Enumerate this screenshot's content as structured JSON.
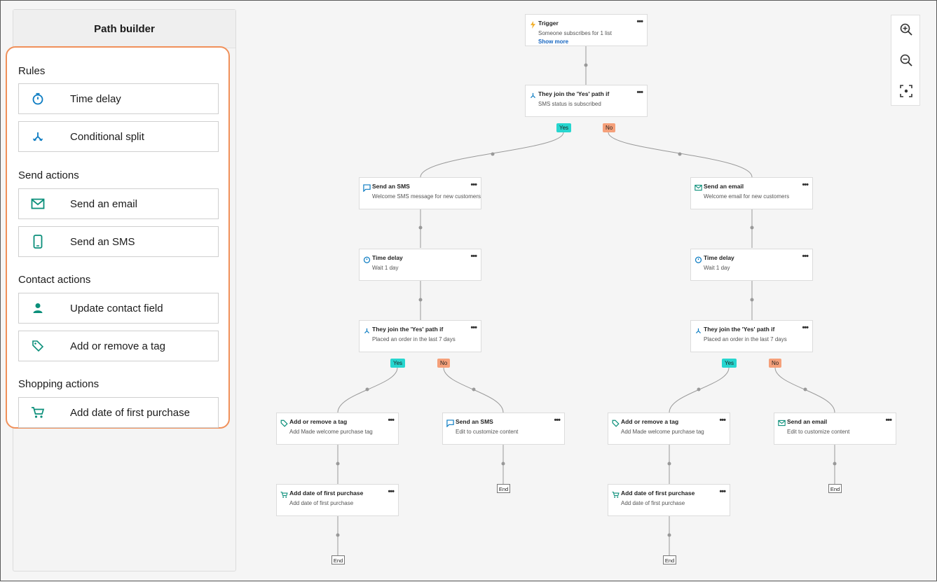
{
  "sidebar": {
    "title": "Path builder",
    "sections": {
      "rules": {
        "title": "Rules",
        "items": [
          {
            "label": "Time delay",
            "icon": "stopwatch-icon"
          },
          {
            "label": "Conditional split",
            "icon": "split-icon"
          }
        ]
      },
      "send": {
        "title": "Send actions",
        "items": [
          {
            "label": "Send an email",
            "icon": "envelope-icon"
          },
          {
            "label": "Send an SMS",
            "icon": "mobile-phone-icon"
          }
        ]
      },
      "contact": {
        "title": "Contact actions",
        "items": [
          {
            "label": "Update contact field",
            "icon": "person-icon"
          },
          {
            "label": "Add or remove a tag",
            "icon": "tag-icon"
          }
        ]
      },
      "shopping": {
        "title": "Shopping actions",
        "items": [
          {
            "label": "Add date of first purchase",
            "icon": "cart-icon"
          }
        ]
      }
    }
  },
  "flow": {
    "trigger": {
      "title": "Trigger",
      "desc": "Someone subscribes for 1 list",
      "link": "Show more"
    },
    "split1": {
      "title": "They join the 'Yes' path if",
      "desc": "SMS status is subscribed"
    },
    "left": {
      "sms": {
        "title": "Send an SMS",
        "desc": "Welcome SMS message for new customers"
      },
      "delay": {
        "title": "Time delay",
        "desc": "Wait 1 day"
      },
      "split": {
        "title": "They join the 'Yes' path if",
        "desc": "Placed an order in the last 7 days"
      },
      "tag": {
        "title": "Add or remove a tag",
        "desc": "Add Made welcome purchase tag"
      },
      "purchase": {
        "title": "Add date of first purchase",
        "desc": "Add date of first purchase"
      },
      "sms2": {
        "title": "Send an SMS",
        "desc": "Edit to customize content"
      }
    },
    "right": {
      "email": {
        "title": "Send an email",
        "desc": "Welcome email for new customers"
      },
      "delay": {
        "title": "Time delay",
        "desc": "Wait 1 day"
      },
      "split": {
        "title": "They join the 'Yes' path if",
        "desc": "Placed an order in the last 7 days"
      },
      "tag": {
        "title": "Add or remove a tag",
        "desc": "Add Made welcome purchase tag"
      },
      "purchase": {
        "title": "Add date of first purchase",
        "desc": "Add date of first purchase"
      },
      "email2": {
        "title": "Send an email",
        "desc": "Edit to customize content"
      }
    },
    "yes_label": "Yes",
    "no_label": "No",
    "end_label": "End",
    "more_label": "•••"
  },
  "colors": {
    "accent_blue": "#0a7bc2",
    "accent_teal": "#0b8f7a",
    "yes_badge": "#27d6cf",
    "no_badge": "#f5a07a",
    "highlight_border": "#f0905a",
    "link": "#1565c0"
  },
  "zoom": {
    "icons": [
      "zoom-in-icon",
      "zoom-out-icon",
      "fit-screen-icon"
    ]
  }
}
